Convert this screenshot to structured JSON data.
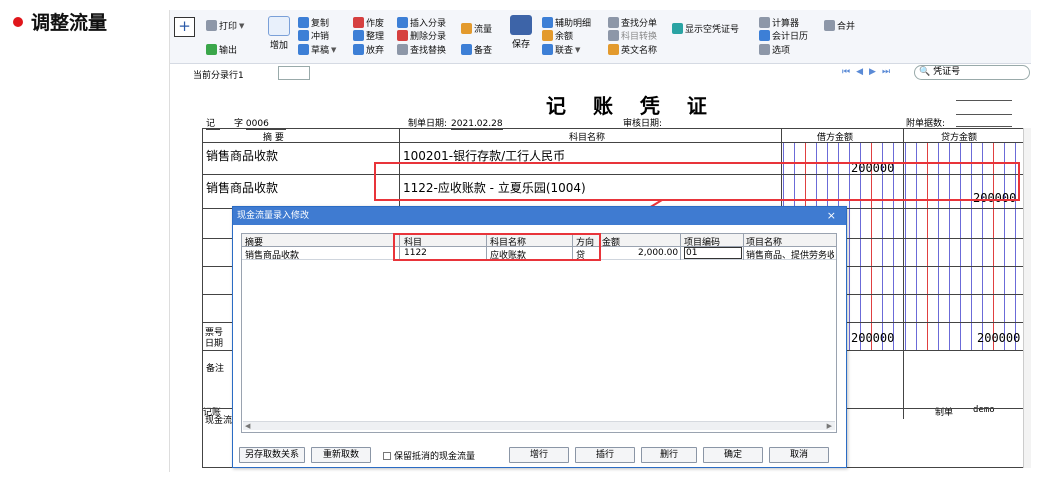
{
  "slide": {
    "title": "调整流量",
    "accent": "#e0161b"
  },
  "toolbar": {
    "add_symbol": "+",
    "print": "打印",
    "export": "输出",
    "add": "增加",
    "copy": "复制",
    "reverse": "冲销",
    "draft": "草稿",
    "void": "作废",
    "tidy": "整理",
    "discard": "放弃",
    "insert_entry": "插入分录",
    "delete_entry": "删除分录",
    "find_replace": "查找替换",
    "flow": "流量",
    "check": "备查",
    "save": "保存",
    "aux_detail": "辅助明细",
    "balance": "余额",
    "query": "联查",
    "find_entry": "查找分单",
    "subject_convert": "科目转换",
    "english_name": "英文名称",
    "show_voucher_no": "显示空凭证号",
    "calculator": "计算器",
    "calendar": "会计日历",
    "options": "选项",
    "merge": "合并"
  },
  "nav": {
    "current_line_label": "当前分录行1",
    "search_placeholder": "凭证号",
    "arrows": [
      "⏮",
      "◀",
      "▶",
      "⏭"
    ]
  },
  "voucher": {
    "title": "记 账 凭 证",
    "type_char": "记",
    "zi_label": "字",
    "number": "0006",
    "date_label": "制单日期:",
    "date_value": "2021.02.28",
    "audit_label": "审核日期:",
    "attach_label": "附单据数:",
    "col_summary": "摘 要",
    "col_subject": "科目名称",
    "col_debit": "借方金额",
    "col_credit": "贷方金额",
    "rows": [
      {
        "summary": "销售商品收款",
        "subject": "100201-银行存款/工行人民币",
        "debit": "200000",
        "credit": ""
      },
      {
        "summary": "销售商品收款",
        "subject": "1122-应收账款 - 立夏乐园(1004)",
        "debit": "",
        "credit": "200000"
      }
    ],
    "ticket_label": "票号",
    "date_label2": "日期",
    "total_debit": "200000",
    "total_credit": "200000",
    "note_label": "备注",
    "bookkeep_label": "记账",
    "cashflow_label": "现金流",
    "maker_label": "制单",
    "maker_value": "demo"
  },
  "dialog": {
    "title": "现金流量录入修改",
    "close": "×",
    "columns": [
      "摘要",
      "科目",
      "科目名称",
      "方向",
      "金额",
      "项目编码",
      "项目名称"
    ],
    "row": {
      "summary": "销售商品收款",
      "subject": "1122",
      "subject_name": "应收账款",
      "direction": "贷",
      "amount": "2,000.00",
      "item_code": "01",
      "item_name": "销售商品、提供劳务收"
    },
    "buttons": {
      "save_relation": "另存取数关系",
      "refetch": "重新取数",
      "keep_label": "保留抵消的现金流量",
      "add_row": "增行",
      "insert_row": "插行",
      "delete_row": "删行",
      "ok": "确定",
      "cancel": "取消"
    }
  }
}
